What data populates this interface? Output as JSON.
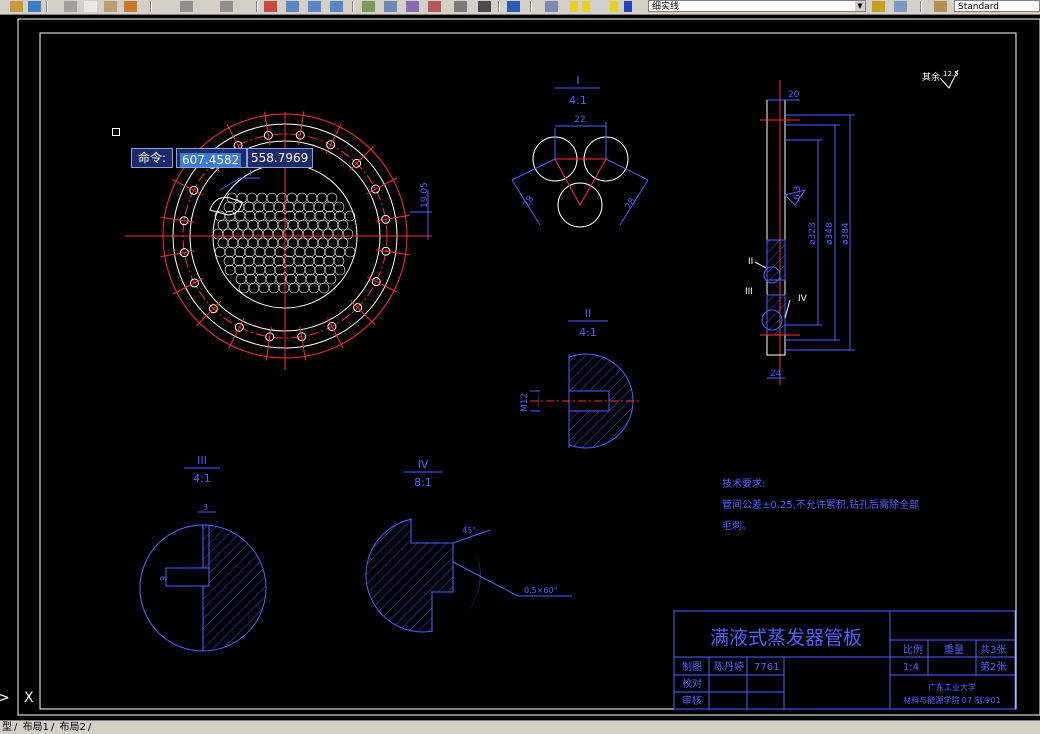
{
  "toolbar": {
    "layer_name": "细实线",
    "text_style": "Standard"
  },
  "command_tooltip": {
    "label": "命令:",
    "x_value": "607.4582",
    "y_value": "558.7969"
  },
  "drawing": {
    "dims": {
      "d1905": "19.05",
      "d22": "22",
      "d28a": "28",
      "d28b": "28",
      "d20": "20",
      "d63": "6.3",
      "d323": "ø323",
      "d348": "ø348",
      "d384": "ø384",
      "d24": "24",
      "m12": "M12",
      "d3": "3",
      "d9": "9",
      "d45": "45°",
      "chamfer": "0.5×60°",
      "surface": "其余",
      "surface_val": "12.5"
    },
    "views": {
      "I": {
        "label": "I",
        "scale": "4:1"
      },
      "II": {
        "label": "II",
        "scale": "4:1"
      },
      "III": {
        "label": "III",
        "scale": "4:1"
      },
      "IV": {
        "label": "IV",
        "scale": "8:1"
      }
    },
    "markers": {
      "I": "I",
      "II": "II",
      "III": "III",
      "IV": "IV"
    },
    "tech_req": {
      "title": "技术要求:",
      "line1": "管间公差±0.25,不允许累积,钻孔后需除全部",
      "line2": "毛刺。"
    },
    "title_block": {
      "title": "满液式蒸发器管板",
      "scale_label": "比例",
      "weight_label": "重量",
      "sheets_total": "共3张",
      "scale_val": "1:4",
      "sheet_no": "第2张",
      "drawn_label": "制图",
      "drawn_name": "陈丹婷",
      "drawn_id": "7761",
      "check_label": "校对",
      "approve_label": "审核",
      "school": "广东工业大学",
      "dept": "材料与能源学院 07 制冷01"
    }
  },
  "status_tabs": [
    "型",
    "布局1",
    "布局2"
  ],
  "ucs_icon": "X"
}
